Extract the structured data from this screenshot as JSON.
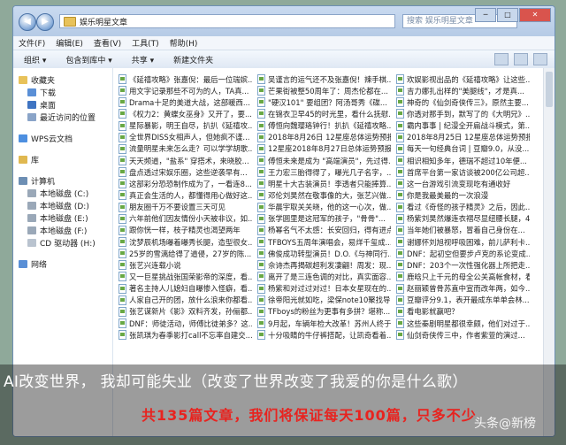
{
  "address": {
    "path": "娱乐明星文章",
    "search_placeholder": "搜索 娱乐明星文章"
  },
  "menu": [
    "文件(F)",
    "编辑(E)",
    "查看(V)",
    "工具(T)",
    "帮助(H)"
  ],
  "toolbar": [
    "组织 ▾",
    "包含到库中 ▾",
    "共享 ▾",
    "新建文件夹"
  ],
  "sidebar": [
    {
      "label": "收藏夹",
      "color": "#e8c25a"
    },
    {
      "label": "下载",
      "color": "#5a8fd6"
    },
    {
      "label": "桌面",
      "color": "#3f74c2"
    },
    {
      "label": "最近访问的位置",
      "color": "#8aa4c8"
    },
    {
      "gap": true
    },
    {
      "label": "WPS云文档",
      "color": "#4d8fe0"
    },
    {
      "gap": true
    },
    {
      "label": "库",
      "color": "#e0b850"
    },
    {
      "gap": true
    },
    {
      "label": "计算机",
      "color": "#6d8fb4"
    },
    {
      "label": "本地磁盘 (C:)",
      "color": "#9aa8b8"
    },
    {
      "label": "本地磁盘 (D:)",
      "color": "#9aa8b8"
    },
    {
      "label": "本地磁盘 (E:)",
      "color": "#9aa8b8"
    },
    {
      "label": "本地磁盘 (F:)",
      "color": "#9aa8b8"
    },
    {
      "label": "CD 驱动器 (H:)",
      "color": "#b9c3cf"
    },
    {
      "gap": true
    },
    {
      "label": "网络",
      "color": "#5a8fd6"
    }
  ],
  "files": [
    [
      "《延禧攻略》张嘉倪：最后一位瑞嫔...",
      "吴谨言的运气还不及张嘉倪！辣手棋...",
      "欢娱影视出品的《延禧攻略》让这些..."
    ],
    [
      "用文字记录那些不可为的人，TA真...",
      "芒果街被整50周年了：周杰伦都在...",
      "吉力娜扎出样的\"美腿线\"，才是真..."
    ],
    [
      "Drama十足的美道大战，这部暖西...",
      "\"硬汉101\" 要组团？阿汤哥秀《碟...",
      "神奇的《仙剑奇侠传三》，原然主要..."
    ],
    [
      "《权力2：黄蝶女巫身》又开了，要...",
      "在锦衣卫早45的时光里，看什么抚慰...",
      "你透对那手到，默写了的《大明兄》..."
    ],
    [
      "星际暴影，明王自尽，扒扒《延禧攻...",
      "傅恒向魏璎珞钟行！扒扒《延禧攻略...",
      "霸内事事 | 纪漫全开扁战斗模式，第..."
    ],
    [
      "全世界DISS女相声人，但她疯不谨...",
      "2018年8月26日 12星座总体运势预报",
      "2018年8月25日 12星座总体运势预报"
    ],
    [
      "流量明星未来怎么走？可以学学胡歌...",
      "12星座2018年8月27日总体运势预报",
      "每天一句经典台词 | 豆瓣9.0，从没..."
    ],
    [
      "天天频道，\"盐系\" 穿搭术，来晓胶...",
      "傅恒未来是成为 \"高端演员\"，先过得...",
      "相识相知多年，德瑞不超过10年便..."
    ],
    [
      "盘点透过宋娱乐圈，这些逆袭早有...",
      "王力宏三胎得得了，曝光几子名字，...",
      "首席平台第一家访谈被200亿公司超..."
    ],
    [
      "这部彩分恐恐制作成为了，一看连8...",
      "明星十大古装演员！李透者只能捧算...",
      "这一台游戏引流变现吃有通收好"
    ],
    [
      "真正会生活的人，都懂得用心做好这...",
      "邓伦刘昊然在敬事像的大，张艺兴做...",
      "你是我最美最的一次浪漫"
    ],
    [
      "朋友圈千万不要设置三天可见",
      "华晨宇取关关晓，他的这一心次，做...",
      "看过《奇怪的孩子精灵》之后，因此..."
    ],
    [
      "六年前他们因友情份小天被非议，如...",
      "张学圆里是这冠军的孩子，\"骨骨\"...",
      "杨紫刘昊然爆连衣褶尽显纽腰长腿，4..."
    ],
    [
      "跟你恍一样，枝子精灵也渴望两年",
      "杨幂名气不太感：长安回归，得有进点...",
      "当年她们被暴怒，冒着自己身份在..."
    ],
    [
      "沈梦辰机场曝着曝秀长腿，造型很女...",
      "TFBOYS五周年演唱会，易烊千玺成...",
      "谢娜怀刘旭视呼吸困难，前儿萨利卡..."
    ],
    [
      "25岁的雪漓给得了道侵，27岁的陈...",
      "佛俊成功转型演员！D.O.《与神同行...",
      "DNF：起初空但要步卢克的系论变成..."
    ],
    [
      "张艺兴连载小说",
      "佘诗杰再揭碳超利发凄翩！周发：现...",
      "DNF：203个一次性强化器上所把走..."
    ],
    [
      "又一巨星挑战张国荣影帝的深度，看...",
      "离开了是三连色调的对比，真实面容...",
      "鹿晗只上千元的母全公关高帐食材，看..."
    ],
    [
      "著名主持人儿媳妇自曝惨入怪癖，看...",
      "杨紫和对过过对过！日本女星现在的...",
      "赵丽颖曾骨苏直中宣而改年两，如今..."
    ],
    [
      "人家自己开的团，放什么浪来你都看...",
      "徐帝阳光就如吃，梁保note10聚找导...",
      "豆瓣评分9.1，表开最成东单单会林..."
    ],
    [
      "张艺谋新片《影》双料齐发，孙俪都...",
      "TFboys的粉丝为更事有多拼？堪称...",
      "看电影就赢吧？"
    ],
    [
      "DNF：师徒活动，师傅比徒弟多？这...",
      "9月起，车辆年检大改革！苏州人终于...",
      "这些秦剧明星都很幸颇，他们对过于..."
    ],
    [
      "张凯琪为春季影打call不忘率自建交...",
      "十分吸睛的牛仔裤搭配，让凯奇看着...",
      "仙剑奇侠传三中，作者紫萱的演过..."
    ]
  ],
  "overlay": {
    "subtitle": "AI改变世界， 我却可能失业（改变了世界改变了我爱的你是什么歌）",
    "banner": "共135篇文章，我们将保证每天100篇，只多不少",
    "watermark": "头条@新榜"
  }
}
